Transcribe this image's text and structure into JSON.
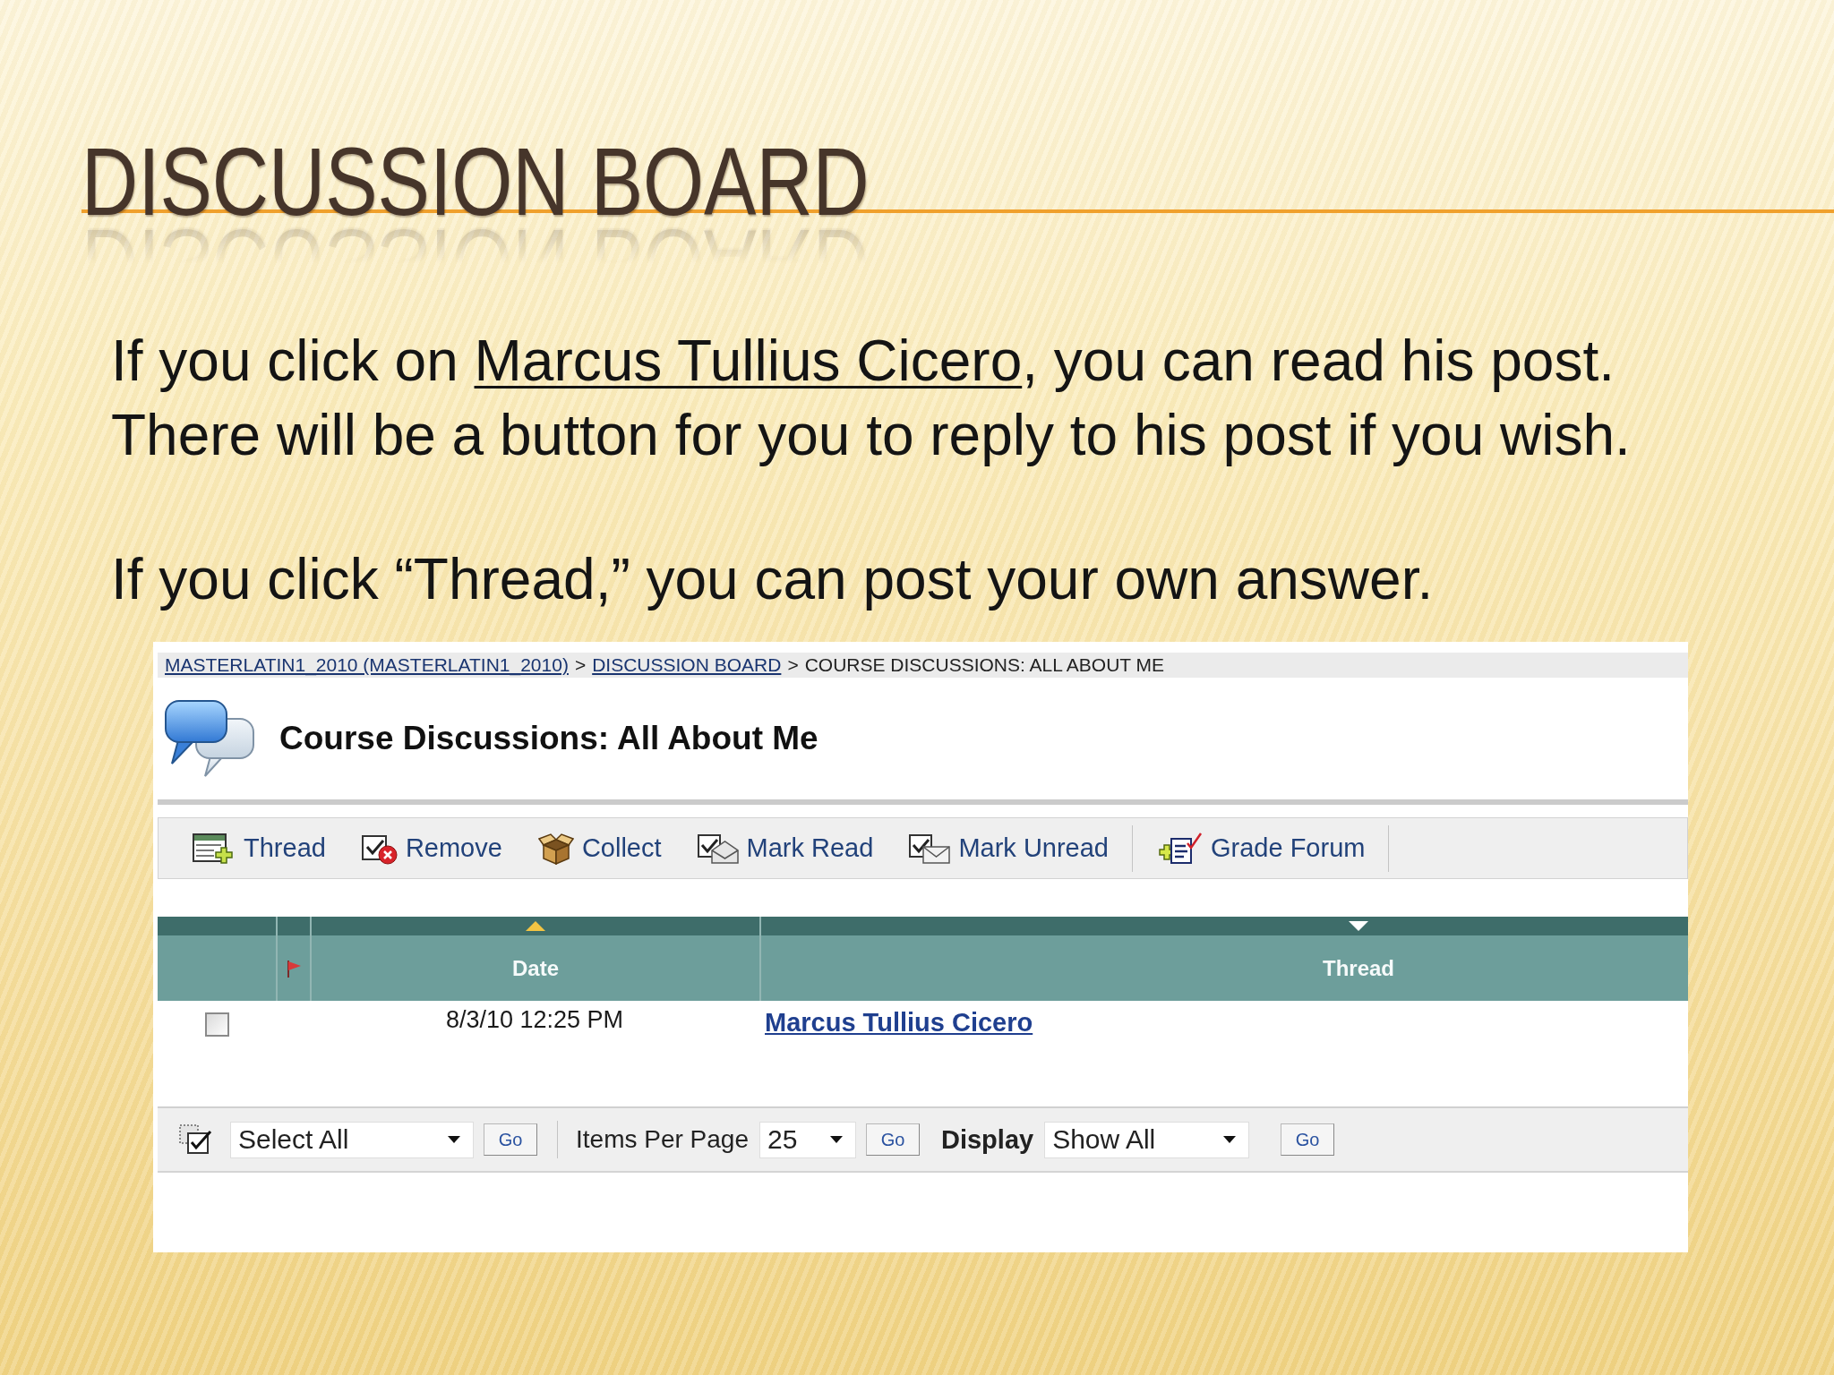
{
  "slide": {
    "title": "DISCUSSION BOARD",
    "paragraphs": [
      [
        {
          "before": "If you click on ",
          "link": "Marcus Tullius Cicero",
          "after": ", you can read his post."
        },
        {
          "before": "There will be a button for you to reply to his post if you wish."
        }
      ],
      [
        {
          "before": "If you click “Thread,” you can post your own answer."
        }
      ]
    ]
  },
  "screenshot": {
    "breadcrumb": [
      {
        "kind": "link",
        "text": "MASTERLATIN1_2010 (MASTERLATIN1_2010)"
      },
      {
        "kind": "separator",
        "text": ">"
      },
      {
        "kind": "link",
        "text": "DISCUSSION BOARD"
      },
      {
        "kind": "separator",
        "text": ">"
      },
      {
        "kind": "current",
        "text": "COURSE DISCUSSIONS: ALL ABOUT ME"
      }
    ],
    "heading": "Course Discussions: All About Me",
    "toolbar": [
      [
        {
          "kind": "add",
          "label": "Thread"
        },
        {
          "kind": "remove",
          "label": "Remove"
        },
        {
          "kind": "collect",
          "label": "Collect"
        },
        {
          "kind": "mark-read",
          "label": "Mark Read"
        },
        {
          "kind": "mark-unread",
          "label": "Mark Unread"
        }
      ],
      [
        {
          "kind": "grade",
          "label": "Grade Forum"
        }
      ]
    ],
    "table": {
      "columns": [
        {
          "kind": "select"
        },
        {
          "kind": "flag"
        },
        {
          "kind": "sortable",
          "label": "Date",
          "descending": false,
          "selected": true
        },
        {
          "kind": "sortable",
          "label": "Thread",
          "descending": true,
          "selected": false
        }
      ],
      "rows": [
        {
          "checked": false,
          "date": "8/3/10 12:25 PM",
          "thread": "Marcus Tullius Cicero"
        }
      ]
    },
    "footer": {
      "bulk_action": {
        "value": "Select All",
        "button": "Go"
      },
      "items_per_page": {
        "label": "Items Per Page",
        "value": "25",
        "button": "Go"
      },
      "display": {
        "label": "Display",
        "value": "Show All",
        "button": "Go"
      }
    }
  }
}
